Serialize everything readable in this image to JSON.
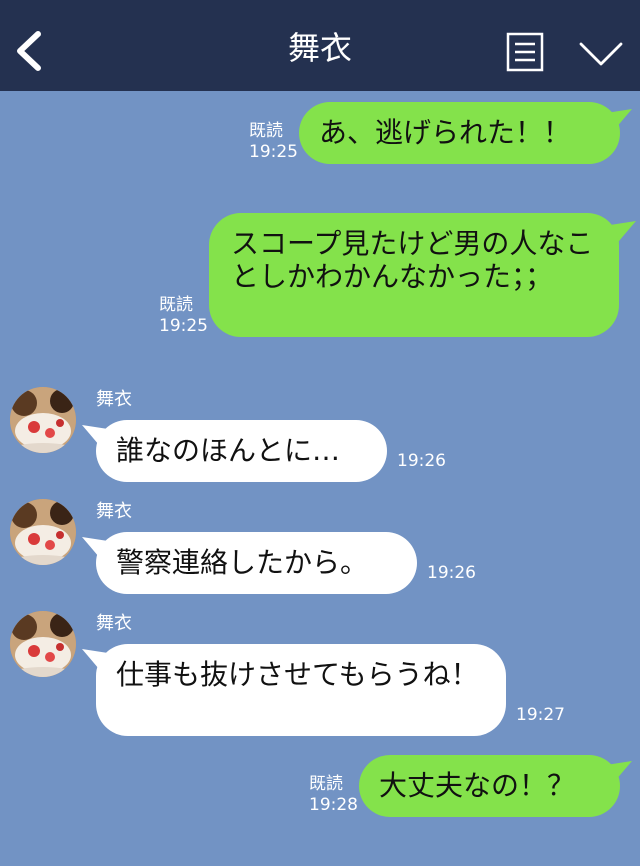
{
  "header": {
    "title": "舞衣",
    "back_icon": "chevron-left-icon",
    "menu_icon": "document-menu-icon",
    "expand_icon": "chevron-down-icon",
    "background": "#243150"
  },
  "theme": {
    "chat_background": "#7293c4",
    "sent_bubble": "#84e24b",
    "received_bubble": "#ffffff"
  },
  "messages": [
    {
      "direction": "sent",
      "read": "既読",
      "time": "19:25",
      "text": "あ、逃げられた！！"
    },
    {
      "direction": "sent",
      "read": "既読",
      "time": "19:25",
      "text": "スコープ見たけど男の人なことしかわかんなかった；；"
    },
    {
      "direction": "received",
      "sender": "舞衣",
      "time": "19:26",
      "text": "誰なのほんとに…"
    },
    {
      "direction": "received",
      "sender": "舞衣",
      "time": "19:26",
      "text": "警察連絡したから。"
    },
    {
      "direction": "received",
      "sender": "舞衣",
      "time": "19:27",
      "text": "仕事も抜けさせてもらうね！"
    },
    {
      "direction": "sent",
      "read": "既読",
      "time": "19:28",
      "text": "大丈夫なの！？"
    }
  ]
}
